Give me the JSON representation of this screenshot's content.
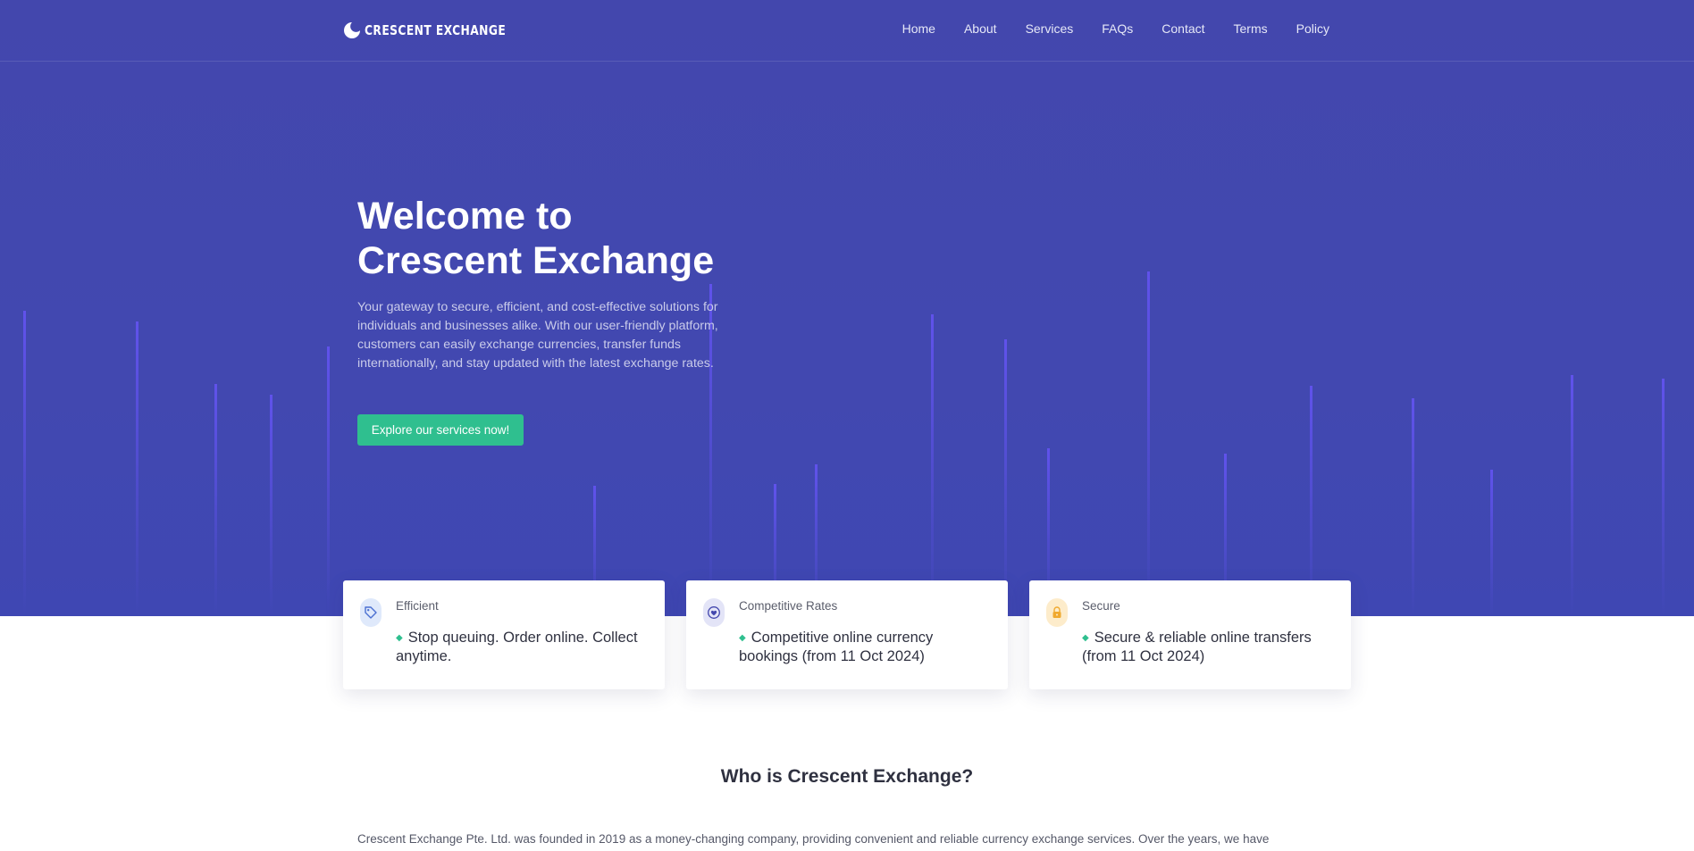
{
  "brand": {
    "name": "CRESCENT EXCHANGE"
  },
  "nav": {
    "items": [
      "Home",
      "About",
      "Services",
      "FAQs",
      "Contact",
      "Terms",
      "Policy"
    ]
  },
  "hero": {
    "title_line1": "Welcome to",
    "title_line2": "Crescent Exchange",
    "description": "Your gateway to secure, efficient, and cost-effective solutions for individuals and businesses alike. With our user-friendly platform, customers can easily exchange currencies, transfer funds internationally, and stay updated with the latest exchange rates.",
    "cta_label": "Explore our services now!"
  },
  "features": [
    {
      "category": "Efficient",
      "text": "Stop queuing. Order online. Collect anytime.",
      "icon": "tag-icon",
      "icon_bg": "#dfe9fb",
      "icon_color": "#4a6fd1"
    },
    {
      "category": "Competitive Rates",
      "text": "Competitive online currency bookings (from 11 Oct 2024)",
      "icon": "heart-icon",
      "icon_bg": "#e3e4f7",
      "icon_color": "#4347ad"
    },
    {
      "category": "Secure",
      "text": "Secure & reliable online transfers (from 11 Oct 2024)",
      "icon": "lock-icon",
      "icon_bg": "#fdeccb",
      "icon_color": "#f0a92f"
    }
  ],
  "about": {
    "title": "Who is Crescent Exchange?",
    "text": "Crescent Exchange Pte. Ltd. was founded in 2019 as a money-changing company, providing convenient and reliable currency exchange services. Over the years, we have"
  },
  "colors": {
    "hero_bg": "#4347ad",
    "accent": "#2fbf8f"
  }
}
